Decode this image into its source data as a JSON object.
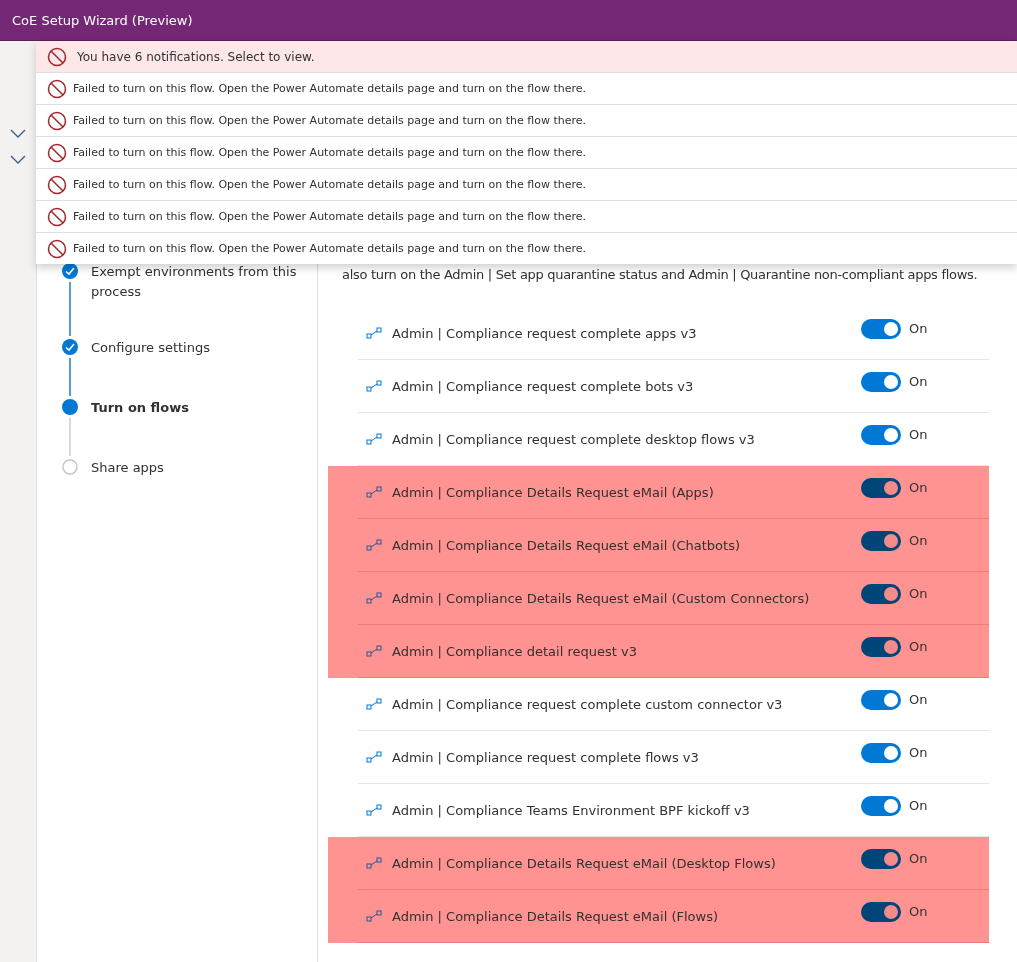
{
  "window": {
    "title": "CoE Setup Wizard (Preview)"
  },
  "notifications": {
    "summary": "You have 6 notifications. Select to view.",
    "items": [
      {
        "message": "Failed to turn on this flow. Open the Power Automate details page and turn on the flow there."
      },
      {
        "message": "Failed to turn on this flow. Open the Power Automate details page and turn on the flow there."
      },
      {
        "message": "Failed to turn on this flow. Open the Power Automate details page and turn on the flow there."
      },
      {
        "message": "Failed to turn on this flow. Open the Power Automate details page and turn on the flow there."
      },
      {
        "message": "Failed to turn on this flow. Open the Power Automate details page and turn on the flow there."
      },
      {
        "message": "Failed to turn on this flow. Open the Power Automate details page and turn on the flow there."
      }
    ]
  },
  "steps": [
    {
      "label": "Exempt environments from this process",
      "completed": true,
      "selected": false
    },
    {
      "label": "Configure settings",
      "completed": true,
      "selected": false
    },
    {
      "label": "Turn on flows",
      "completed": false,
      "selected": true
    },
    {
      "label": "Share apps",
      "completed": false,
      "selected": false
    }
  ],
  "description": "also turn on the Admin | Set app quarantine status and Admin | Quarantine non-compliant apps flows.",
  "flows": [
    {
      "name": "Admin | Compliance request complete apps v3",
      "on": true,
      "state_label": "On",
      "highlighted": false
    },
    {
      "name": "Admin | Compliance request complete bots v3",
      "on": true,
      "state_label": "On",
      "highlighted": false
    },
    {
      "name": "Admin | Compliance request complete desktop flows v3",
      "on": true,
      "state_label": "On",
      "highlighted": false
    },
    {
      "name": "Admin | Compliance Details Request eMail (Apps)",
      "on": true,
      "state_label": "On",
      "highlighted": true
    },
    {
      "name": "Admin | Compliance Details Request eMail (Chatbots)",
      "on": true,
      "state_label": "On",
      "highlighted": true
    },
    {
      "name": "Admin | Compliance Details Request eMail (Custom Connectors)",
      "on": true,
      "state_label": "On",
      "highlighted": true
    },
    {
      "name": "Admin | Compliance detail request v3",
      "on": true,
      "state_label": "On",
      "highlighted": true
    },
    {
      "name": "Admin | Compliance request complete custom connector v3",
      "on": true,
      "state_label": "On",
      "highlighted": false
    },
    {
      "name": "Admin | Compliance request complete flows v3",
      "on": true,
      "state_label": "On",
      "highlighted": false
    },
    {
      "name": "Admin | Compliance Teams Environment BPF kickoff v3",
      "on": true,
      "state_label": "On",
      "highlighted": false
    },
    {
      "name": "Admin | Compliance Details Request eMail (Desktop Flows)",
      "on": true,
      "state_label": "On",
      "highlighted": true
    },
    {
      "name": "Admin | Compliance Details Request eMail (Flows)",
      "on": true,
      "state_label": "On",
      "highlighted": true
    }
  ]
}
